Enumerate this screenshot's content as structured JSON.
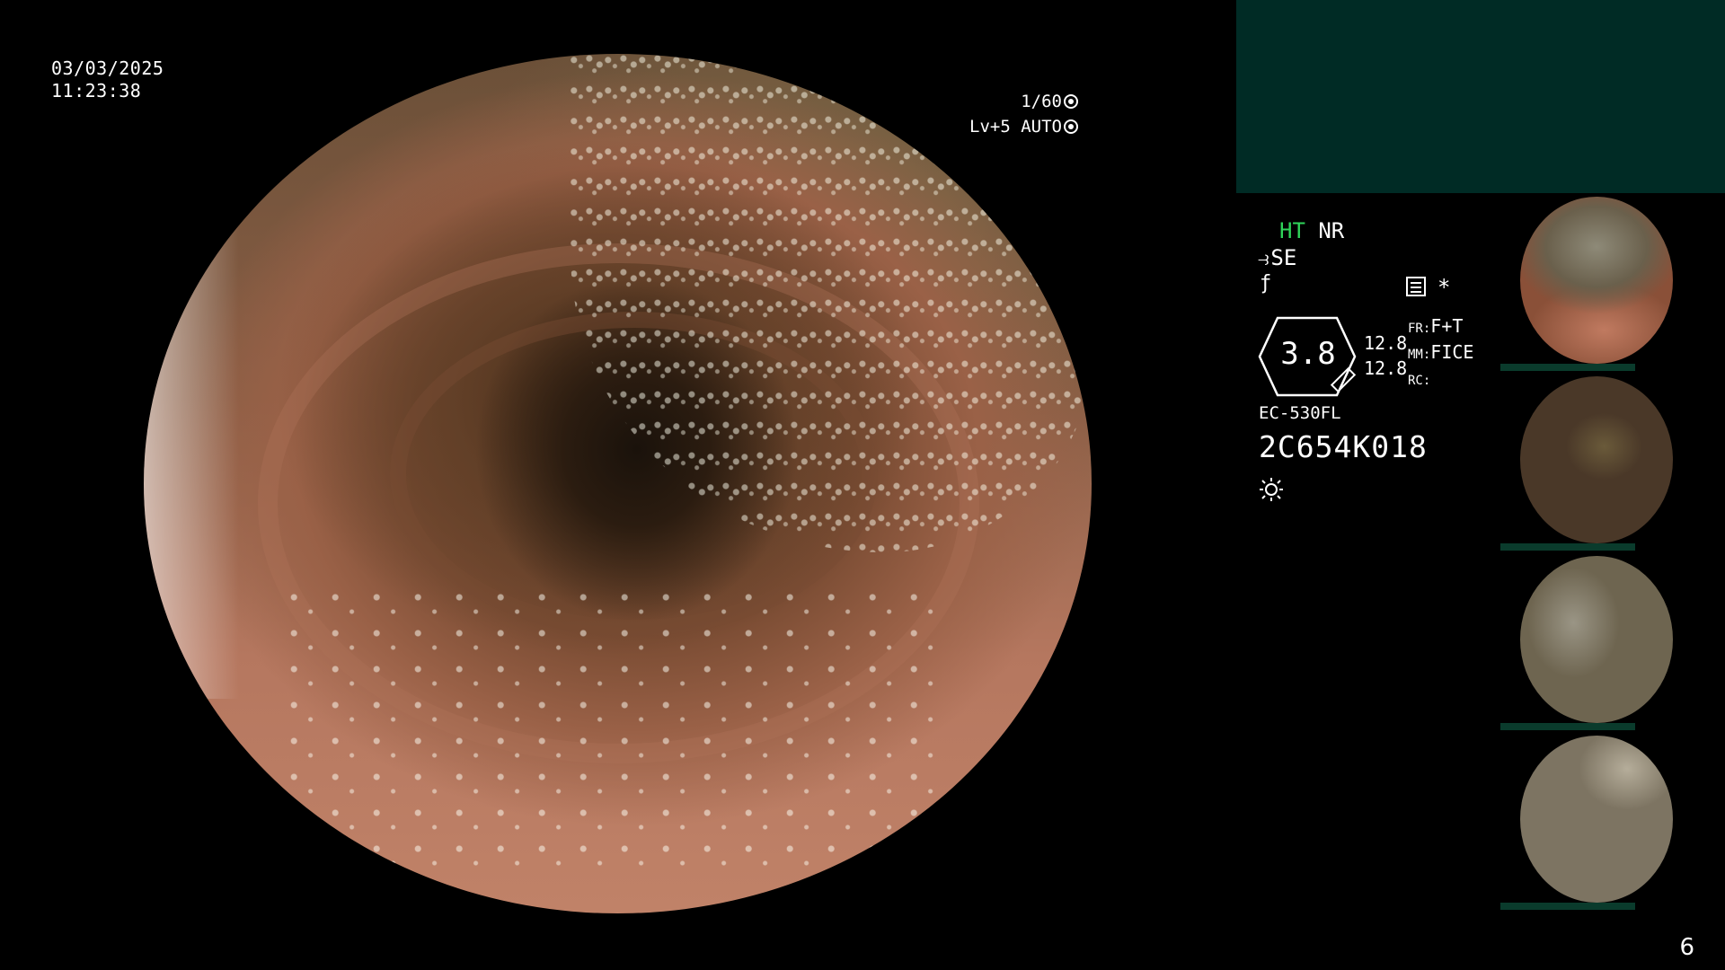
{
  "datetime": {
    "date": "03/03/2025",
    "time": "11:23:38"
  },
  "exposure": {
    "shutter": "1/60",
    "level": "Lv+5",
    "mode": "AUTO",
    "shutter_icon": "aperture-icon",
    "mode_icon": "iris-icon"
  },
  "settings": {
    "ht": "HT",
    "nr": "NR",
    "se": "SE",
    "scope_icon": "scope-hook-icon",
    "curve_icon": "curve-icon",
    "menu_icon": "menu-list-icon",
    "star": "*",
    "hexagon_value": "3.8",
    "values": [
      "12.8",
      "12.8"
    ],
    "labels": [
      "FR:",
      "MM:",
      "RC:"
    ],
    "label_values": [
      "F+T",
      "FICE",
      ""
    ],
    "model": "EC-530FL",
    "serial": "2C654K018",
    "light_icon": "sun-icon"
  },
  "colors": {
    "ht": "#2fd45a",
    "panel": "#002b25",
    "strip": "#0a3b2c"
  },
  "page_number": "6"
}
